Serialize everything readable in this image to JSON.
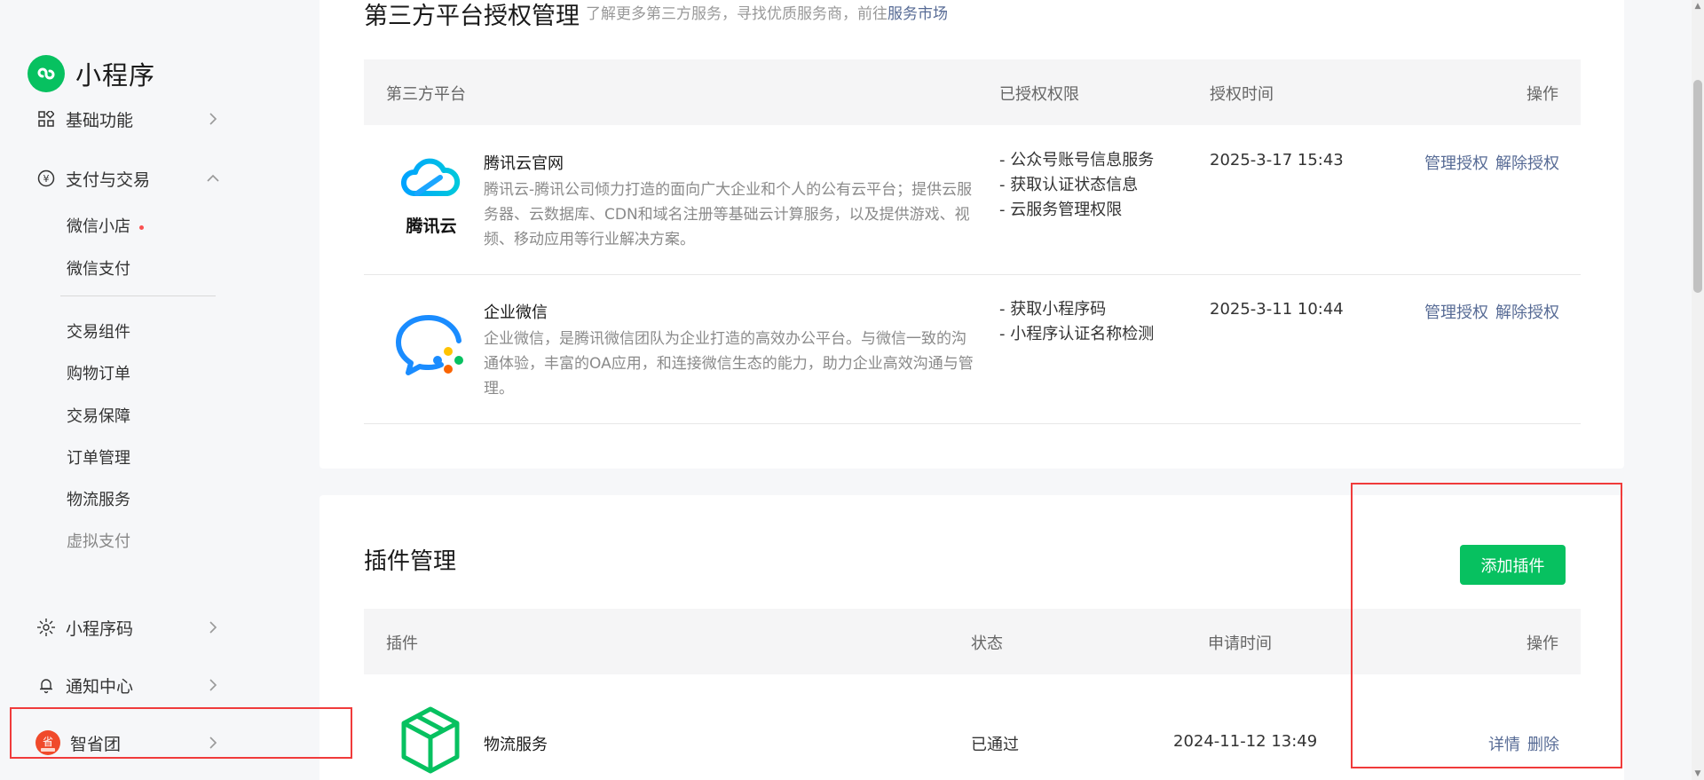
{
  "sidebar": {
    "logo_text": "小程序",
    "items": [
      {
        "label": "基础功能"
      },
      {
        "label": "支付与交易"
      },
      {
        "label": "小程序码"
      },
      {
        "label": "通知中心"
      },
      {
        "label": "智省团"
      }
    ],
    "sub_items": [
      "微信小店",
      "微信支付",
      "交易组件",
      "购物订单",
      "交易保障",
      "订单管理",
      "物流服务",
      "虚拟支付"
    ],
    "app_icon_text": "省"
  },
  "third_party": {
    "title": "第三方平台授权管理",
    "desc_prefix": "了解更多第三方服务，寻找优质服务商，前往",
    "desc_link": "服务市场",
    "headers": {
      "platform": "第三方平台",
      "perms": "已授权权限",
      "time": "授权时间",
      "ops": "操作"
    },
    "rows": [
      {
        "logo_text": "腾讯云",
        "name": "腾讯云官网",
        "desc": "腾讯云-腾讯公司倾力打造的面向广大企业和个人的公有云平台；提供云服务器、云数据库、CDN和域名注册等基础云计算服务，以及提供游戏、视频、移动应用等行业解决方案。",
        "perms": [
          "- 公众号账号信息服务",
          "- 获取认证状态信息",
          "- 云服务管理权限"
        ],
        "time": "2025-3-17 15:43",
        "op_manage": "管理授权",
        "op_revoke": "解除授权"
      },
      {
        "name": "企业微信",
        "desc": "企业微信，是腾讯微信团队为企业打造的高效办公平台。与微信一致的沟通体验，丰富的OA应用，和连接微信生态的能力，助力企业高效沟通与管理。",
        "perms": [
          "- 获取小程序码",
          "- 小程序认证名称检测"
        ],
        "time": "2025-3-11 10:44",
        "op_manage": "管理授权",
        "op_revoke": "解除授权"
      }
    ]
  },
  "plugins": {
    "title": "插件管理",
    "add_label": "添加插件",
    "headers": {
      "plugin": "插件",
      "status": "状态",
      "time": "申请时间",
      "ops": "操作"
    },
    "rows": [
      {
        "name": "物流服务",
        "status": "已通过",
        "time": "2024-11-12 13:49",
        "op_detail": "详情",
        "op_delete": "删除"
      }
    ]
  },
  "colors": {
    "accent": "#07c160",
    "link": "#576b95",
    "highlight": "#f03b3b"
  }
}
